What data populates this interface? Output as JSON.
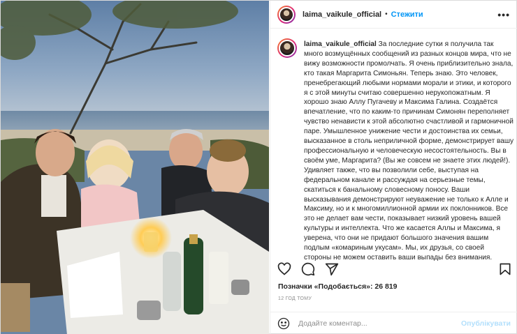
{
  "post": {
    "username": "laima_vaikule_official",
    "follow_label": "Стежити",
    "separator": "•",
    "more_label": "•••",
    "caption": "За последние сутки я получила так много возмущённых сообщений из разных концов мира, что не вижу возможности промолчать. Я очень приблизительно знала, кто такая Маргарита Симоньян. Теперь знаю. Это человек, пренебрегающий любыми нормами морали и этики, и которого я с этой минуты считаю совершенно нерукопожатным. Я хорошо знаю Аллу Пугачеву и Максима Галина. Создаётся впечатление, что по каким-то причинам Симонян переполняет чувство ненависти к этой абсолютно счастливой и гармоничной паре. Умышленное унижение чести и достоинства их семьи, высказанное в столь неприличной форме, демонстрирует вашу профессиональную и человеческую несостоятельность. Вы в своём уме, Маргарита? (Вы же совсем не знаете этих людей!). Удивляет также, что вы позволили себе, выступая на федеральном канале и рассуждая на серьезные темы, скатиться к банальному словесному поносу. Ваши высказывания демонстрируют неуважение не только к Алле и Максиму, но и к многомиллионной армии их поклонников. Все это не делает вам чести, показывает низкий уровень вашей культуры и интеллекта. Что же касается Аллы и Максима, я уверена, что они не придают большого значения вашим подлым «комариным укусам». Мы, их друзья, со своей стороны не можем оставить ваши выпады без внимания.",
    "likes_text": "Позначки «Подобається»: 26 819",
    "time_text": "12 ГОД ТОМУ"
  },
  "actions": {
    "like_icon": "heart-icon",
    "comment_icon": "comment-icon",
    "share_icon": "share-icon",
    "save_icon": "bookmark-icon"
  },
  "comment": {
    "placeholder": "Додайте коментар...",
    "publish_label": "Опублікувати",
    "emoji_icon": "smiley-icon"
  },
  "colors": {
    "accent": "#0095f6",
    "publish_disabled": "#b2dffc",
    "muted": "#8e8e8e",
    "text": "#262626"
  }
}
